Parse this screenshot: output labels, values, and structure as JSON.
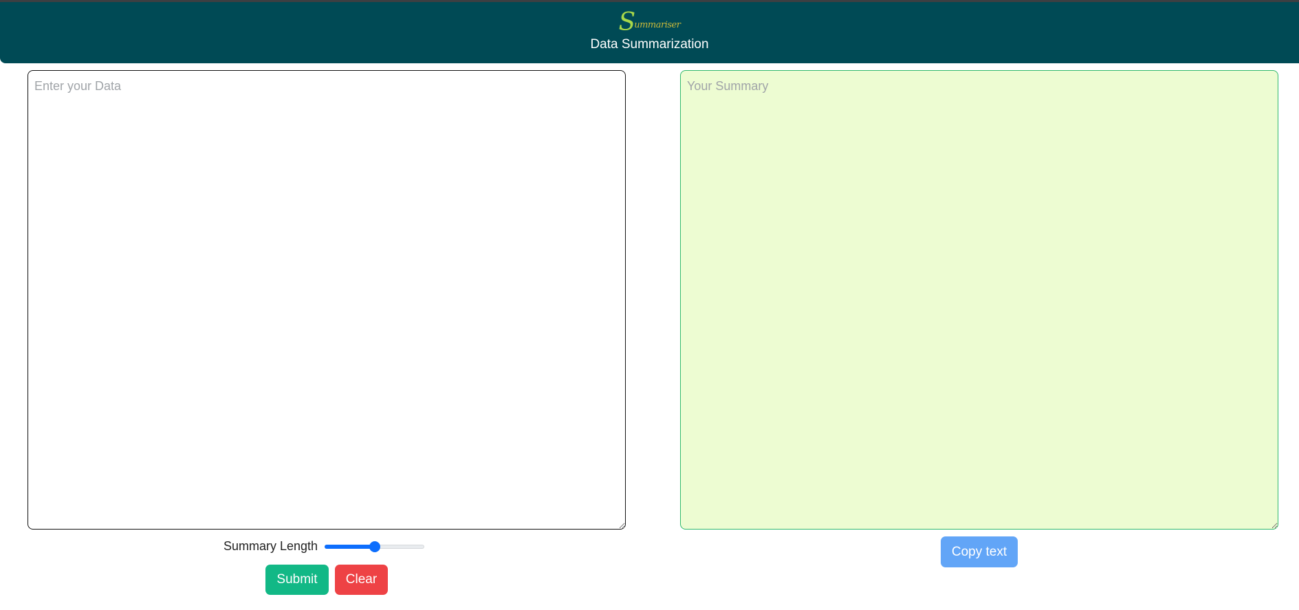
{
  "header": {
    "logo_initial": "S",
    "logo_text": "ummariser",
    "title": "Data Summarization"
  },
  "input": {
    "placeholder": "Enter your Data",
    "value": ""
  },
  "summary": {
    "placeholder": "Your Summary",
    "value": ""
  },
  "controls": {
    "length_label": "Summary Length",
    "slider_value_fraction": 0.5,
    "submit_label": "Submit",
    "clear_label": "Clear",
    "copy_label": "Copy text"
  },
  "colors": {
    "header_bg": "#004a55",
    "submit": "#12b886",
    "clear": "#ee4245",
    "copy": "#62a5f7",
    "summary_bg": "#edfcd2",
    "slider_accent": "#0d6efd"
  }
}
